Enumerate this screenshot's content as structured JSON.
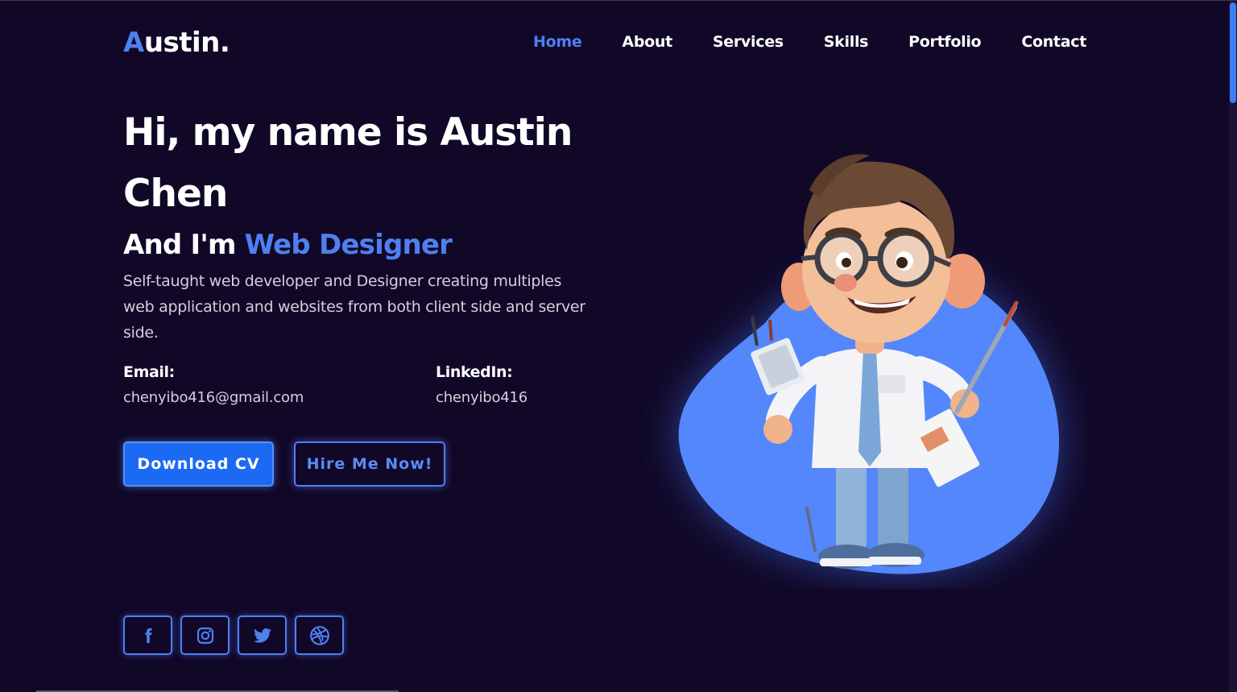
{
  "header": {
    "logo_first": "A",
    "logo_rest": "ustin.",
    "nav": [
      "Home",
      "About",
      "Services",
      "Skills",
      "Portfolio",
      "Contact"
    ],
    "active_nav": "Home"
  },
  "hero": {
    "headline": "Hi, my name is Austin Chen",
    "subhead_prefix": "And I'm",
    "subhead_role": "Web Designer",
    "description": "Self-taught web developer and Designer creating multiples web application and websites from both client side and server side.",
    "email_label": "Email:",
    "email_value": "chenyibo416@gmail.com",
    "linkedin_label": "LinkedIn:",
    "linkedin_value": "chenyibo416",
    "download_label": "Download CV",
    "hire_label": "Hire Me Now!"
  },
  "social": [
    "facebook-icon",
    "instagram-icon",
    "twitter-icon",
    "dribbble-icon"
  ],
  "colors": {
    "background": "#110828",
    "accent": "#4f7ff0",
    "button": "#1c6af3"
  }
}
